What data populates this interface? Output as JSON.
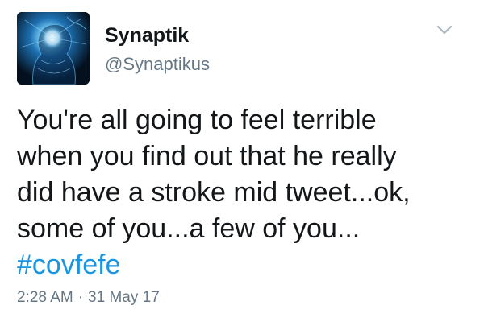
{
  "user": {
    "display_name": "Synaptik",
    "handle": "@Synaptikus",
    "avatar_icon": "glowing-brain-head-avatar"
  },
  "header": {
    "menu_icon": "chevron-down-icon"
  },
  "tweet": {
    "text_lines": [
      "You're all going to feel terrible",
      "when you find out that he really",
      "did have a stroke mid tweet...ok,",
      "some of you...a few of you..."
    ],
    "hashtag": "#covfefe",
    "time": "2:28 AM",
    "separator": "·",
    "date": "31 May 17"
  },
  "colors": {
    "text": "#14171a",
    "secondary": "#657786",
    "link": "#1b95e0",
    "background": "#ffffff"
  }
}
